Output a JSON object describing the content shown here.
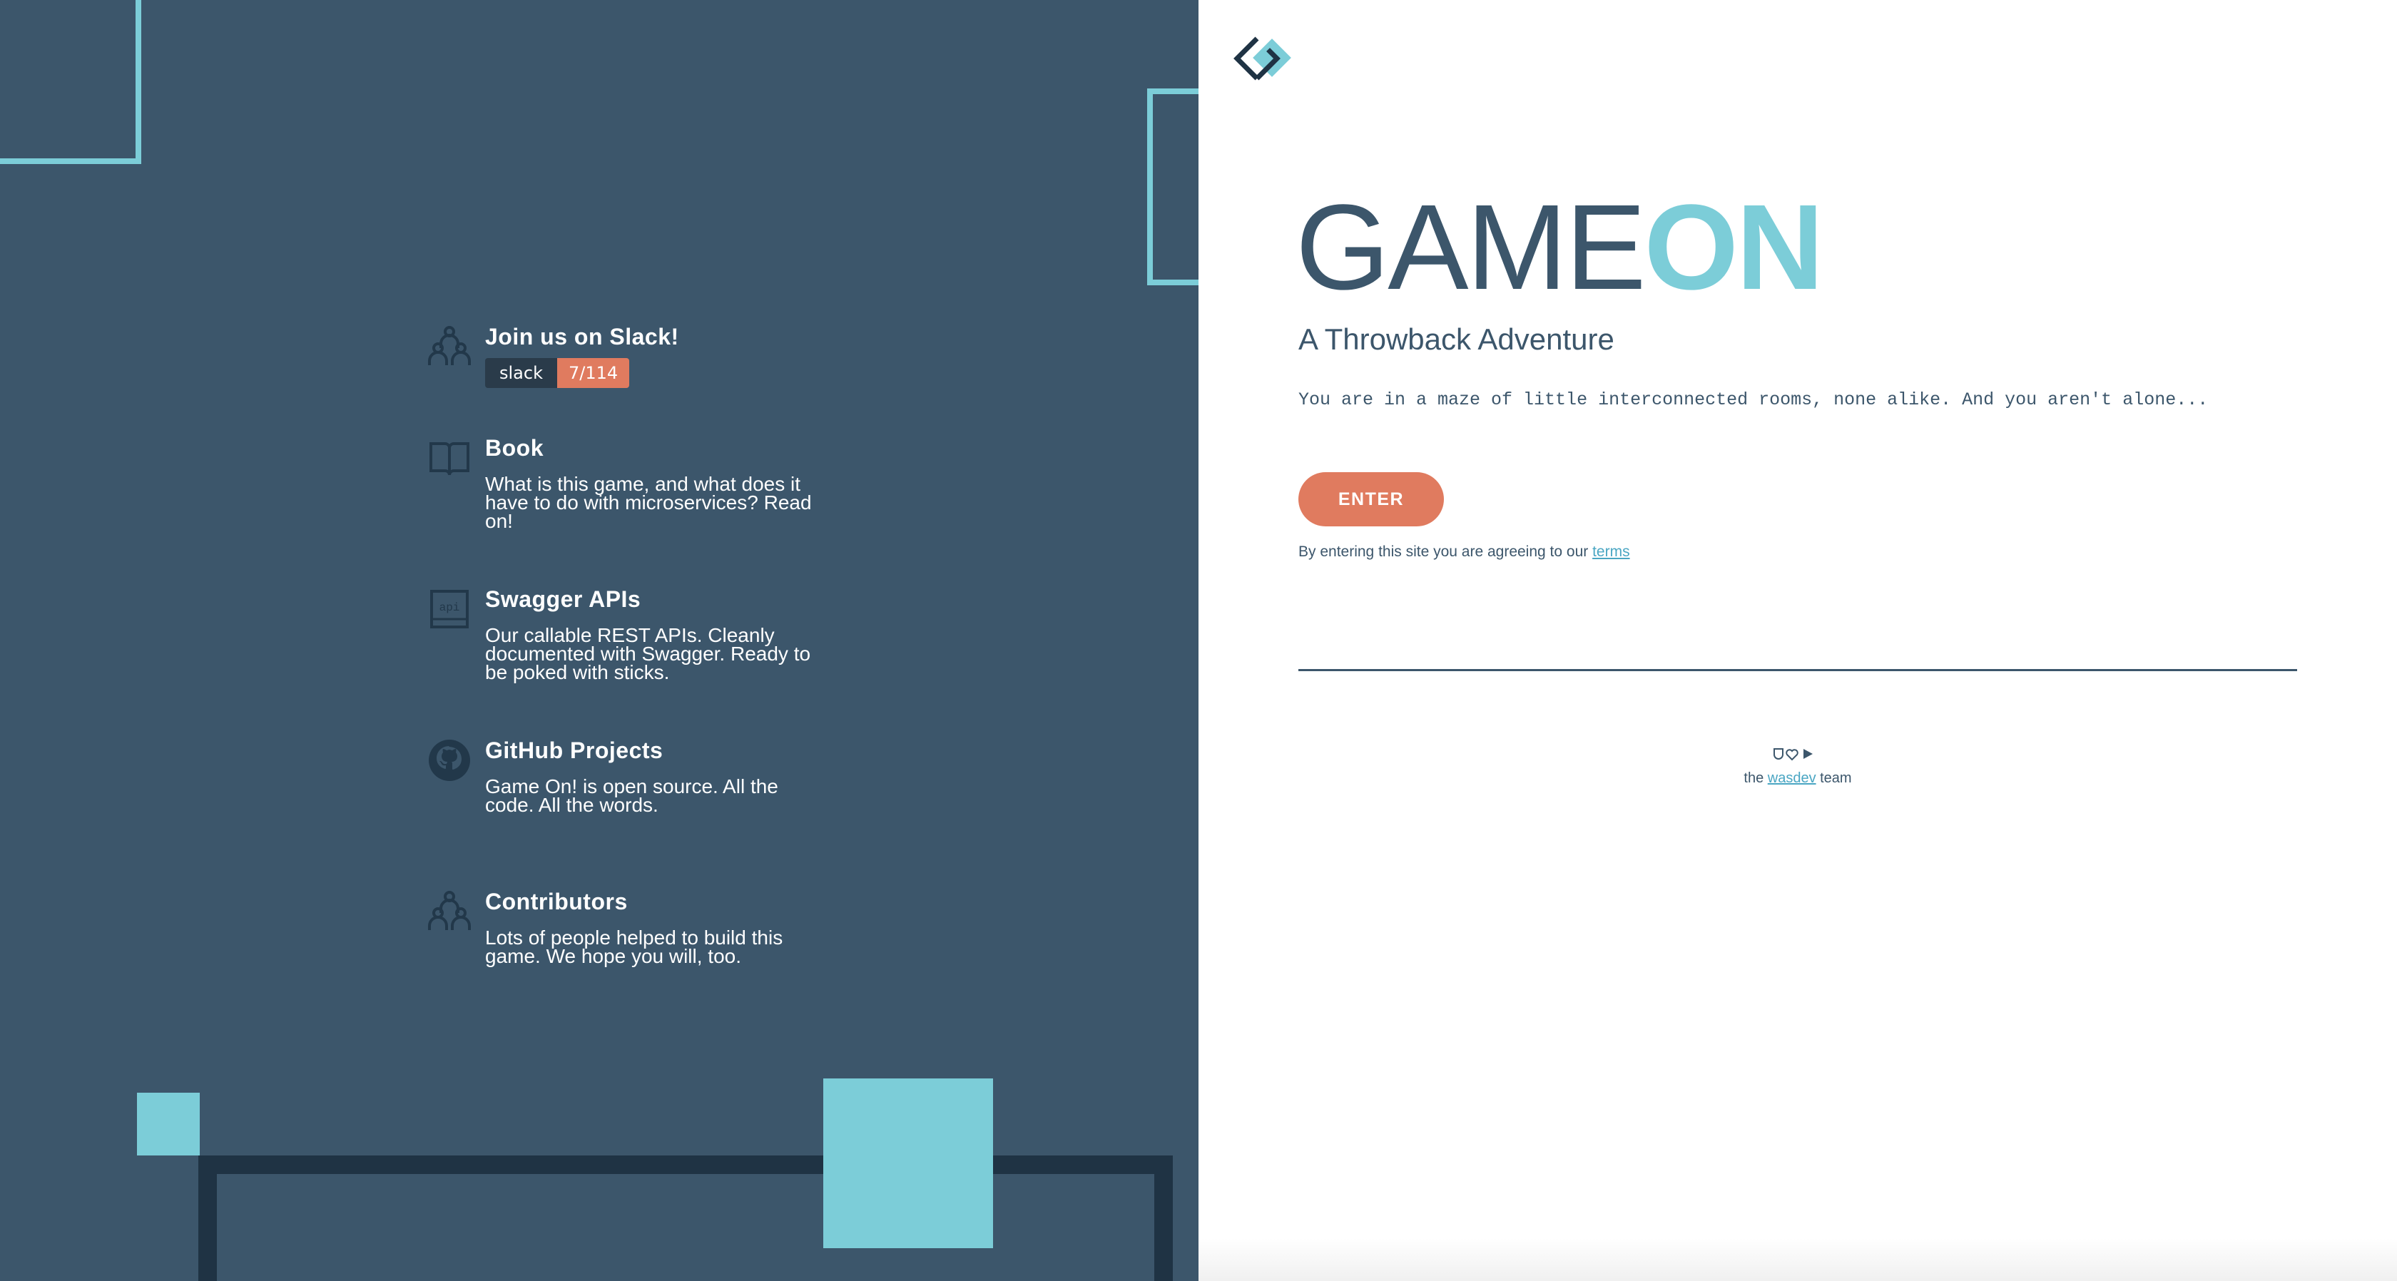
{
  "sidebar": {
    "items": [
      {
        "title": "Join us on Slack!",
        "badge": {
          "label": "slack",
          "count": "7/114"
        }
      },
      {
        "title": "Book",
        "description": "What is this game, and what does it have to do with microservices? Read on!"
      },
      {
        "title": "Swagger APIs",
        "description": "Our callable REST APIs. Cleanly documented with Swagger. Ready to be poked with sticks.",
        "icon_text": "api"
      },
      {
        "title": "GitHub Projects",
        "description": "Game On! is open source. All the code. All the words."
      },
      {
        "title": "Contributors",
        "description": "Lots of people helped to build this game. We hope you will, too."
      }
    ]
  },
  "brand": {
    "word1": "GAME",
    "word2": "ON"
  },
  "subtitle": "A Throwback Adventure",
  "tagline": "You are in a maze of little interconnected rooms, none alike. And you aren't alone...",
  "enter_label": "ENTER",
  "terms": {
    "prefix": "By entering this site you are agreeing to our ",
    "link": "terms"
  },
  "footer": {
    "prefix": "the ",
    "link": "wasdev",
    "suffix": " team"
  },
  "colors": {
    "panel": "#3c566b",
    "accent": "#7ccdd8",
    "button": "#e07b5f",
    "link": "#4aa6c3",
    "dark": "#1f3344"
  },
  "icons": [
    "people-icon",
    "book-icon",
    "api-icon",
    "github-icon",
    "people-icon",
    "gameon-logo-icon",
    "shield-icon",
    "heart-icon",
    "play-icon"
  ]
}
